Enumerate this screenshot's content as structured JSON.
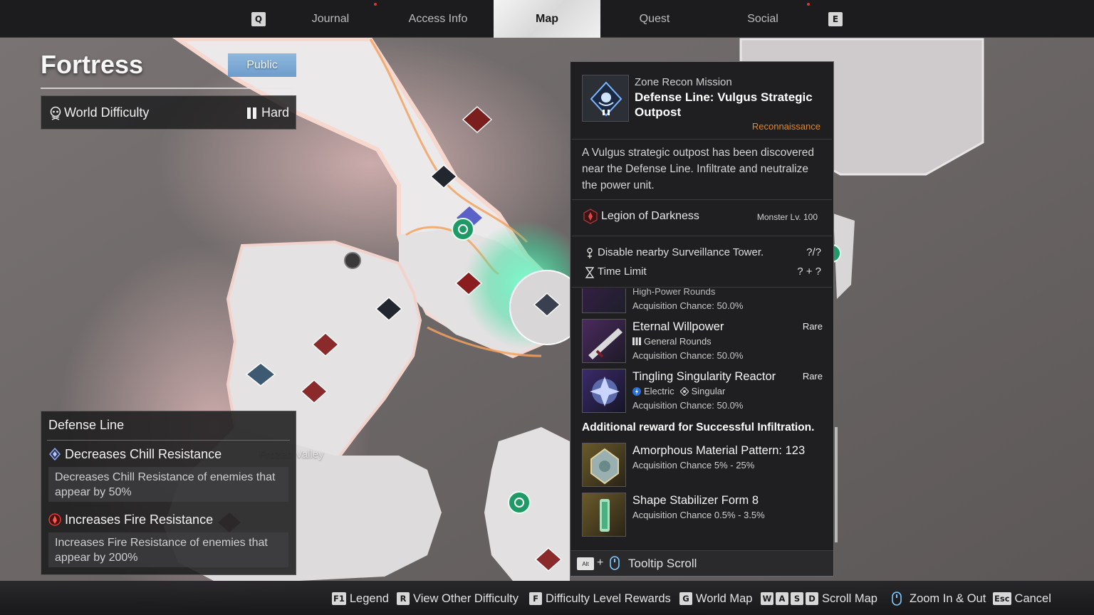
{
  "nav": {
    "left_key": "Q",
    "right_key": "E",
    "tabs": [
      {
        "label": "Journal",
        "active": false,
        "alert": true
      },
      {
        "label": "Access Info",
        "active": false,
        "alert": false
      },
      {
        "label": "Map",
        "active": true,
        "alert": false
      },
      {
        "label": "Quest",
        "active": false,
        "alert": false
      },
      {
        "label": "Social",
        "active": false,
        "alert": true
      }
    ]
  },
  "zone": {
    "title": "Fortress",
    "visibility": "Public",
    "difficulty_label": "World Difficulty",
    "difficulty_value": "Hard",
    "difficulty_icon": "skull-icon"
  },
  "defense_line": {
    "title": "Defense Line",
    "modifiers": [
      {
        "title": "Decreases Chill Resistance",
        "desc": "Decreases Chill Resistance of enemies that appear by 50%",
        "icon": "chill-icon",
        "color": "#6d8fd6"
      },
      {
        "title": "Increases Fire Resistance",
        "desc": "Increases Fire Resistance of enemies that appear by 200%",
        "icon": "fire-icon",
        "color": "#d33a3a"
      }
    ]
  },
  "map_labels": {
    "frozen_valley": "Frozen Valley"
  },
  "tooltip": {
    "mission_type": "Zone Recon Mission",
    "mission_name": "Defense Line: Vulgus Strategic Outpost",
    "category": "Reconnaissance",
    "category_color": "#e6852a",
    "description": "A Vulgus strategic outpost has been discovered near the Defense Line. Infiltrate and neutralize the power unit.",
    "faction": "Legion of Darkness",
    "monster_level": "Monster Lv. 100",
    "objectives": [
      {
        "text": "Disable nearby Surveillance Tower.",
        "value": "?/?",
        "icon": "tower-icon"
      },
      {
        "text": "Time Limit",
        "value": "? + ?",
        "icon": "hourglass-icon"
      }
    ],
    "rewards": [
      {
        "name": "High-Power Rounds",
        "rarity": "",
        "sub": "",
        "chance": "Acquisition Chance: 50.0%"
      },
      {
        "name": "Eternal Willpower",
        "rarity": "Rare",
        "sub": "General Rounds",
        "chance": "Acquisition Chance: 50.0%"
      },
      {
        "name": "Tingling Singularity Reactor",
        "rarity": "Rare",
        "sub_a": "Electric",
        "sub_b": "Singular",
        "chance": "Acquisition Chance: 50.0%"
      }
    ],
    "additional_label": "Additional reward for Successful Infiltration.",
    "additional_rewards": [
      {
        "name": "Amorphous Material Pattern: 123",
        "chance": "Acquisition Chance 5% - 25%"
      },
      {
        "name": "Shape Stabilizer Form 8",
        "chance": "Acquisition Chance 0.5% - 3.5%"
      }
    ],
    "footer_key": "Alt",
    "footer_plus": "+",
    "footer_label": "Tooltip Scroll"
  },
  "hints": [
    {
      "keys": [
        "F1"
      ],
      "label": "Legend"
    },
    {
      "keys": [
        "R"
      ],
      "label": "View Other Difficulty"
    },
    {
      "keys": [
        "F"
      ],
      "label": "Difficulty Level Rewards"
    },
    {
      "keys": [
        "G"
      ],
      "label": "World Map"
    },
    {
      "keys": [
        "W",
        "A",
        "S",
        "D"
      ],
      "label": "Scroll Map"
    },
    {
      "keys": [],
      "label": "Zoom In & Out"
    },
    {
      "keys": [
        "Esc"
      ],
      "label": "Cancel"
    }
  ]
}
